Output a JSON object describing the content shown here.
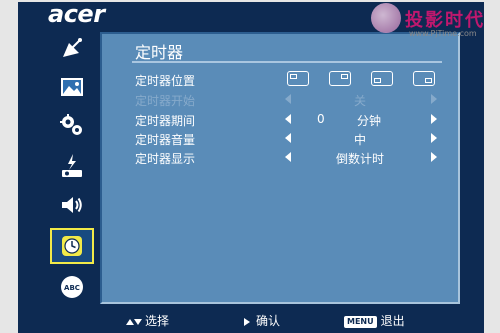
{
  "brand": "acer",
  "watermark": {
    "text": "投影时代",
    "url": "www.PjTime.com"
  },
  "sidebar": {
    "items": [
      {
        "name": "satellite-dish-icon",
        "active": false
      },
      {
        "name": "image-icon",
        "active": false
      },
      {
        "name": "gears-icon",
        "active": false
      },
      {
        "name": "lamp-power-icon",
        "active": false
      },
      {
        "name": "speaker-icon",
        "active": false
      },
      {
        "name": "clock-icon",
        "active": true
      },
      {
        "name": "language-abc-icon",
        "active": false
      }
    ]
  },
  "panel": {
    "title": "定时器",
    "rows": [
      {
        "label": "定时器位置",
        "type": "positions"
      },
      {
        "label": "定时器开始",
        "type": "select",
        "value": "关",
        "disabled": true
      },
      {
        "label": "定时器期间",
        "type": "number",
        "value": "0",
        "unit": "分钟"
      },
      {
        "label": "定时器音量",
        "type": "select",
        "value": "中"
      },
      {
        "label": "定时器显示",
        "type": "select",
        "value": "倒数计时"
      }
    ]
  },
  "footer": {
    "select_label": "选择",
    "confirm_label": "确认",
    "menu_key": "MENU",
    "exit_label": "退出"
  }
}
